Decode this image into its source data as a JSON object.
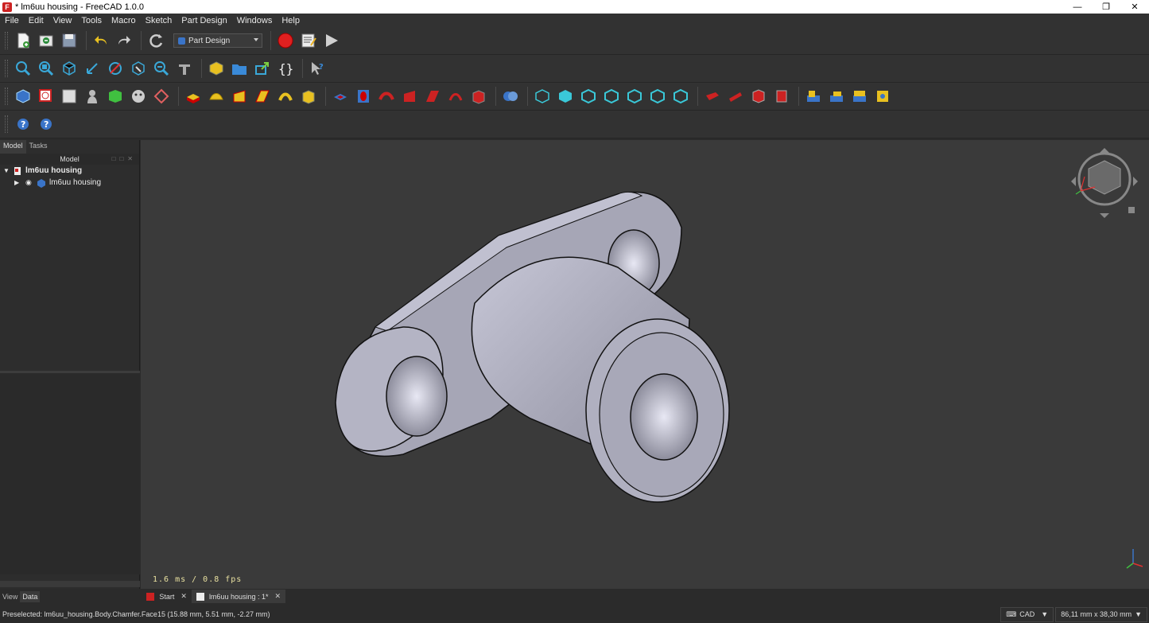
{
  "window": {
    "title": "* lm6uu housing - FreeCAD 1.0.0",
    "app_icon": "F"
  },
  "menu": [
    "File",
    "Edit",
    "View",
    "Tools",
    "Macro",
    "Sketch",
    "Part Design",
    "Windows",
    "Help"
  ],
  "workbench": {
    "selected": "Part Design"
  },
  "left_panel": {
    "tabs": [
      "Model",
      "Tasks"
    ],
    "header": "Model",
    "tree": [
      {
        "label": "lm6uu housing",
        "level": 0
      },
      {
        "label": "lm6uu housing",
        "level": 1
      }
    ],
    "bottom_tabs": [
      "View",
      "Data"
    ]
  },
  "viewport": {
    "fps_text": "1.6 ms / 0.8 fps"
  },
  "doc_tabs": [
    {
      "label": "Start"
    },
    {
      "label": "lm6uu housing : 1*"
    }
  ],
  "status": {
    "message": "Preselected: lm6uu_housing.Body.Chamfer.Face15 (15.88 mm, 5.51 mm, -2.27 mm)",
    "nav_style": "CAD",
    "dimensions": "86,11 mm x 38,30 mm"
  },
  "colors": {
    "accent": "#3a74c8",
    "record": "#e02020",
    "viewport_bg": "#3a3a3a",
    "model": "#b8b8c8"
  },
  "window_buttons": [
    "minimize",
    "restore",
    "close"
  ]
}
